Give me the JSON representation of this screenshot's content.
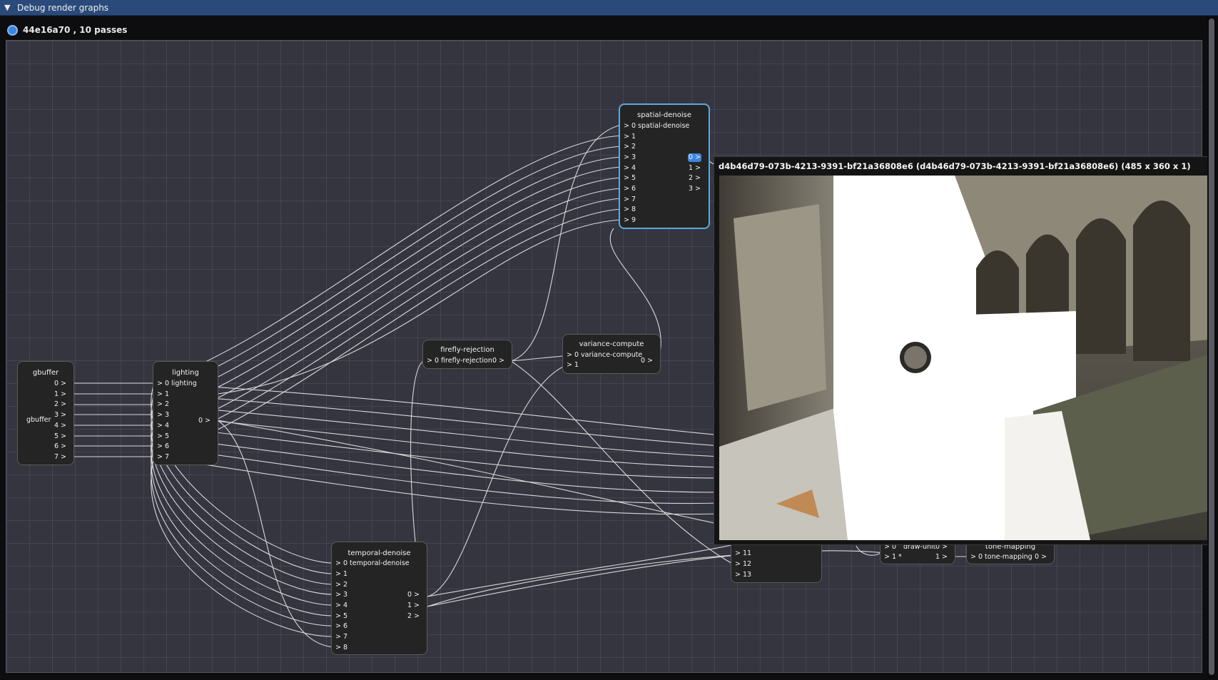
{
  "window": {
    "title": "Debug render graphs"
  },
  "graph": {
    "name": "44e16a70 , 10 passes"
  },
  "nodes": {
    "gbuffer": {
      "title": "gbuffer",
      "label": "gbuffer",
      "outputs": [
        "0 >",
        "1 >",
        "2 >",
        "3 >",
        "4 >",
        "5 >",
        "6 >",
        "7 >"
      ]
    },
    "lighting": {
      "title": "lighting",
      "input0": "> 0  lighting",
      "inputs": [
        "> 1",
        "> 2",
        "> 3",
        "> 4",
        "> 5",
        "> 6",
        "> 7"
      ],
      "outputs": [
        "0 >"
      ]
    },
    "spatial_denoise": {
      "title": "spatial-denoise",
      "input0": "> 0  spatial-denoise",
      "inputs": [
        "> 1",
        "> 2",
        "> 3",
        "> 4",
        "> 5",
        "> 6",
        "> 7",
        "> 8",
        "> 9"
      ],
      "outputs": [
        "0 >",
        "1 >",
        "2 >",
        "3 >"
      ]
    },
    "firefly_rejection": {
      "title": "firefly-rejection",
      "input0": "> 0  firefly-rejection",
      "outputs": [
        "0 >"
      ]
    },
    "variance_compute": {
      "title": "variance-compute",
      "input0": "> 0  variance-compute",
      "inputs": [
        "> 1"
      ],
      "outputs": [
        "0 >"
      ]
    },
    "temporal_denoise": {
      "title": "temporal-denoise",
      "input0": "> 0  temporal-denoise",
      "inputs": [
        "> 1",
        "> 2",
        "> 3",
        "> 4",
        "> 5",
        "> 6",
        "> 7",
        "> 8"
      ],
      "outputs": [
        "0 >",
        "1 >",
        "2 >"
      ]
    },
    "composite": {
      "inputs": [
        "> 11",
        "> 12",
        "> 13"
      ]
    },
    "draw_unit": {
      "title": "draw-unit",
      "input0": "> 0 ",
      "input1": "> 1 *",
      "outputs": [
        "0 >",
        "1 >"
      ]
    },
    "tone_mapping": {
      "title": "tone-mapping",
      "input0": "> 0  tone-mapping",
      "outputs": [
        "0 >"
      ]
    }
  },
  "preview": {
    "title": "d4b46d79-073b-4213-9391-bf21a36808e6 (d4b46d79-073b-4213-9391-bf21a36808e6) (485 x 360 x 1)"
  },
  "colors": {
    "canvas": "#353540",
    "node": "#242424",
    "selected_border": "#5fa8dc",
    "wire": "#e6e6e6",
    "titlebar": "#294a7a"
  },
  "icons": {
    "collapse": "triangle-down-icon",
    "graph": "circle-icon"
  }
}
